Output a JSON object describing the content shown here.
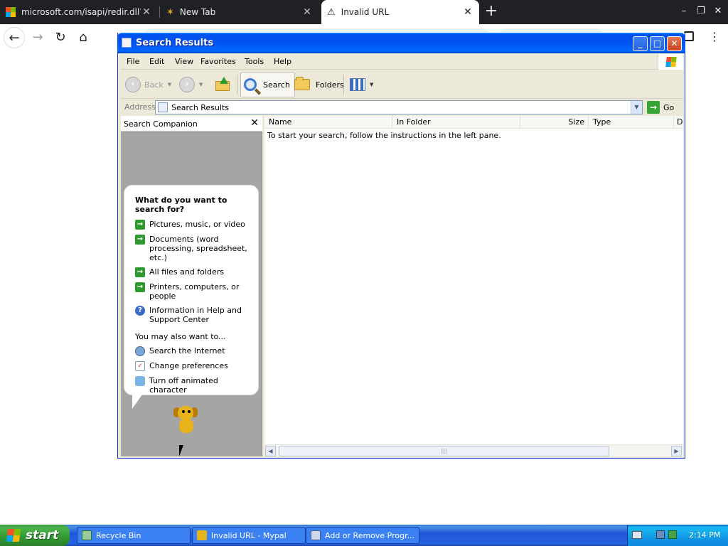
{
  "browser": {
    "tabs": [
      {
        "title": "microsoft.com/isapi/redir.dll?prd=",
        "close": "✕"
      },
      {
        "title": "New Tab",
        "close": "✕"
      },
      {
        "title": "Invalid URL",
        "close": "✕"
      }
    ],
    "new_tab": "+",
    "controls": {
      "minimize": "–",
      "restore": "❐",
      "close": "✕"
    },
    "nav": {
      "back": "←",
      "forward": "→",
      "reload": "↻",
      "home": "⌂"
    },
    "menu": "⋮"
  },
  "window": {
    "title": "Search Results",
    "controls": {
      "minimize": "_",
      "maximize": "□",
      "close": "✕"
    },
    "menus": [
      "File",
      "Edit",
      "View",
      "Favorites",
      "Tools",
      "Help"
    ],
    "toolbar": {
      "back": "Back",
      "search": "Search",
      "folders": "Folders"
    },
    "address": {
      "label": "Address",
      "value": "Search Results",
      "go": "Go"
    },
    "companion": {
      "title": "Search Companion",
      "close": "✕",
      "question": "What do you want to search for?",
      "options": [
        "Pictures, music, or video",
        "Documents (word processing, spreadsheet, etc.)",
        "All files and folders",
        "Printers, computers, or people",
        "Information in Help and Support Center"
      ],
      "also_heading": "You may also want to...",
      "also": [
        "Search the Internet",
        "Change preferences",
        "Turn off animated character"
      ]
    },
    "results": {
      "columns": [
        "Name",
        "In Folder",
        "Size",
        "Type",
        "D"
      ],
      "message": "To start your search, follow the instructions in the left pane."
    }
  },
  "taskbar": {
    "start": "start",
    "buttons": [
      "Recycle Bin",
      "Invalid URL - Mypal",
      "Add or Remove Progr..."
    ],
    "clock": "2:14 PM"
  },
  "icons": {
    "tab_microsoft": "microsoft-logo-icon",
    "tab_newtab": "mypal-icon",
    "tab_invalid": "warning-icon",
    "rover": "search-dog-icon"
  },
  "colors": {
    "xp_title_blue": "#0053ee",
    "taskbar_blue": "#2157d7",
    "start_green": "#319831",
    "browser_dark": "#202124"
  }
}
